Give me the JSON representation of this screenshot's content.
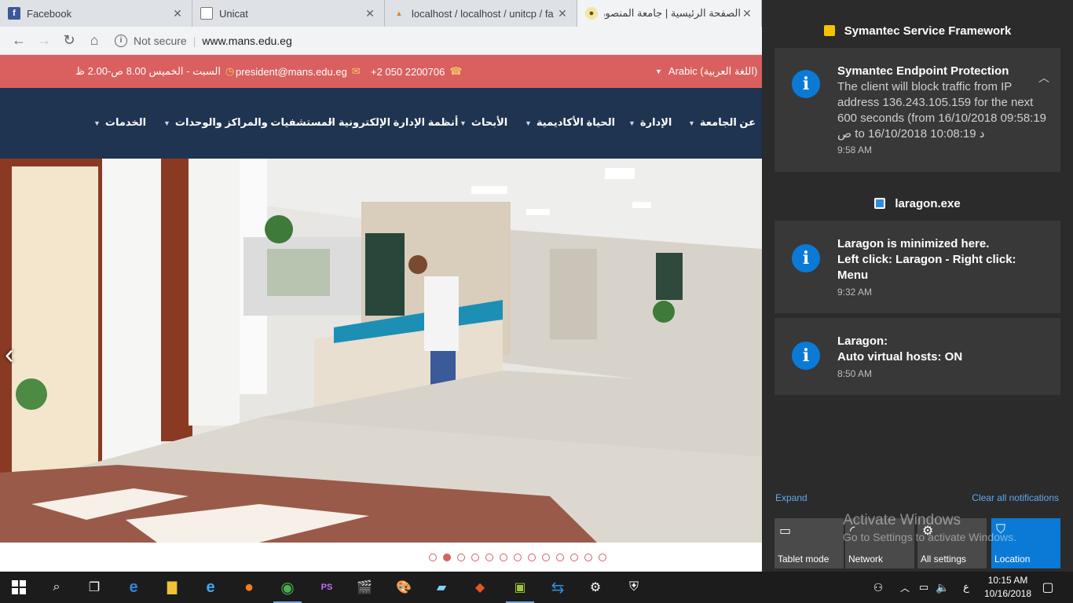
{
  "browser": {
    "tabs": [
      {
        "title": "Facebook",
        "icon": "facebook-icon"
      },
      {
        "title": "Unicat",
        "icon": "document-icon"
      },
      {
        "title": "localhost / localhost / unitcp / fa",
        "icon": "phpmyadmin-icon"
      },
      {
        "title": "الصفحة الرئيسية | جامعة المنصورة",
        "icon": "mansoura-logo-icon"
      }
    ],
    "security_label": "Not secure",
    "url": "www.mans.edu.eg"
  },
  "site": {
    "topbar": {
      "language": "Arabic (اللغة العربية)",
      "phone": "+2 050 2200706",
      "email": "president@mans.edu.eg",
      "hours": "السبت - الخميس 8.00 ص-2.00 ظ"
    },
    "nav": [
      "عن الجامعة",
      "الإدارة",
      "الحياة الأكاديمية",
      "الأبحاث",
      "أنظمة الإدارة الإلكترونية",
      "المستشفيات والمراكز والوحدات",
      "الخدمات"
    ],
    "slider": {
      "total_slides": 13,
      "active_slide": 2
    }
  },
  "action_center": {
    "groups": [
      {
        "app": "Symantec Service Framework",
        "notifications": [
          {
            "title": "Symantec Endpoint Protection",
            "body": "The client will block traffic from IP address 136.243.105.159 for the next 600 seconds (from 16/10/2018 09:58:19 ص to 16/10/2018 10:08:19 د",
            "time": "9:58 AM"
          }
        ]
      },
      {
        "app": "laragon.exe",
        "notifications": [
          {
            "title": "Laragon is minimized here.\nLeft click: Laragon - Right click: Menu",
            "time": "9:32 AM"
          },
          {
            "title": "Laragon:\nAuto virtual hosts: ON",
            "time": "8:50 AM"
          }
        ]
      }
    ],
    "expand_label": "Expand",
    "clear_label": "Clear all notifications",
    "quick_actions": [
      {
        "label": "Tablet mode",
        "icon": "tablet-mode-icon",
        "on": false
      },
      {
        "label": "Network",
        "icon": "network-icon",
        "on": false
      },
      {
        "label": "All settings",
        "icon": "settings-icon",
        "on": false
      },
      {
        "label": "Location",
        "icon": "location-icon",
        "on": true
      }
    ],
    "watermark": {
      "line1": "Activate Windows",
      "line2": "Go to Settings to activate Windows."
    }
  },
  "taskbar": {
    "input_lang": "ع",
    "time": "10:15 AM",
    "date": "10/16/2018"
  },
  "colors": {
    "topbar": "#d9605e",
    "nav": "#1f3450",
    "accent_blue": "#0a7ad6",
    "action_center": "#2b2b2b"
  }
}
